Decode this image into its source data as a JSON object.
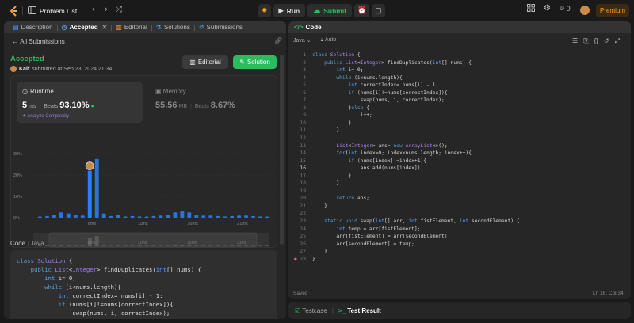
{
  "topbar": {
    "title": "Problem List",
    "run_label": "Run",
    "submit_label": "Submit",
    "streak_count": "0",
    "premium_label": "Premium",
    "brand_color": "#ffa116",
    "accent_green": "#2cbb5d"
  },
  "left_tabs": [
    {
      "label": "Description",
      "icon": "description-icon"
    },
    {
      "label": "Accepted",
      "icon": "clock-icon"
    },
    {
      "label": "Editorial",
      "icon": "editorial-icon"
    },
    {
      "label": "Solutions",
      "icon": "flask-icon"
    },
    {
      "label": "Submissions",
      "icon": "history-icon"
    }
  ],
  "submission": {
    "back_label": "All Submissions",
    "status": "Accepted",
    "user": "Kaif",
    "submitted_text": "submitted at Sep 23, 2024 21:34",
    "editorial_button": "Editorial",
    "solution_button": "Solution",
    "runtime_label": "Runtime",
    "runtime_value": "5",
    "runtime_unit": "ms",
    "beats_label": "Beats",
    "runtime_beats": "93.10%",
    "analyze_label": "Analyze Complexity",
    "memory_label": "Memory",
    "memory_value": "55.56",
    "memory_unit": "MB",
    "memory_beats": "8.67%"
  },
  "chart_data": {
    "type": "bar",
    "y_ticks": [
      "30%",
      "20%",
      "10%",
      "0%"
    ],
    "ylim": [
      0,
      30
    ],
    "x_ticks": [
      "6ms",
      "11ms",
      "16ms",
      "21ms",
      "26ms"
    ],
    "values": [
      0.5,
      0.8,
      1.5,
      2.5,
      2,
      1.5,
      1,
      22,
      27.5,
      2,
      0.8,
      1.2,
      0.5,
      0.8,
      0.6,
      0.5,
      0.8,
      1,
      1.5,
      2.5,
      3,
      2.5,
      1.5,
      1,
      1,
      0.8,
      0.6,
      0.8,
      1,
      1,
      0.8,
      0.6,
      0.5
    ],
    "highlight_index": 7,
    "bar_color": "#2b7fff",
    "grid": true
  },
  "code_section": {
    "label": "Code",
    "lang": "Java",
    "lines": [
      "class Solution {",
      "    public List<Integer> findDuplicates(int[] nums) {",
      "        int i= 0;",
      "        while (i<nums.length){",
      "            int correctIndex= nums[i] - 1;",
      "            if (nums[i]!=nums[correctIndex]){",
      "                swap(nums, i, correctIndex);",
      "            }else {"
    ]
  },
  "editor": {
    "title": "Code",
    "language": "Java",
    "autosave": "Auto",
    "saved_status": "Saved",
    "cursor": "Ln 16, Col 34",
    "line_numbers": [
      "1",
      "2",
      "3",
      "4",
      "5",
      "6",
      "7",
      "8",
      "9",
      "10",
      "11",
      "12",
      "13",
      "14",
      "15",
      "16",
      "17",
      "18",
      "19",
      "20",
      "21",
      "22",
      "23",
      "24",
      "25",
      "26",
      "27",
      "28"
    ],
    "lines": [
      "class Solution {",
      "    public List<Integer> findDuplicates(int[] nums) {",
      "        int i= 0;",
      "        while (i<nums.length){",
      "            int correctIndex= nums[i] - 1;",
      "            if (nums[i]!=nums[correctIndex]){",
      "                swap(nums, i, correctIndex);",
      "            }else {",
      "                i++;",
      "            }",
      "        }",
      "",
      "        List<Integer> ans= new ArrayList<>();",
      "        for(int index=0; index<nums.length; index++){",
      "            if (nums[index]!=index+1){",
      "                ans.add(nums[index]);",
      "            }",
      "        }",
      "",
      "        return ans;",
      "    }",
      "",
      "    static void swap(int[] arr, int fistElement, int secondElement) {",
      "        int temp = arr[fistElement];",
      "        arr[fistElement] = arr[secondElement];",
      "        arr[secondElement] = temp;",
      "    }",
      "}"
    ]
  },
  "bottom_tabs": [
    {
      "label": "Testcase",
      "icon": "checkbox-icon"
    },
    {
      "label": "Test Result",
      "icon": "terminal-icon"
    }
  ]
}
